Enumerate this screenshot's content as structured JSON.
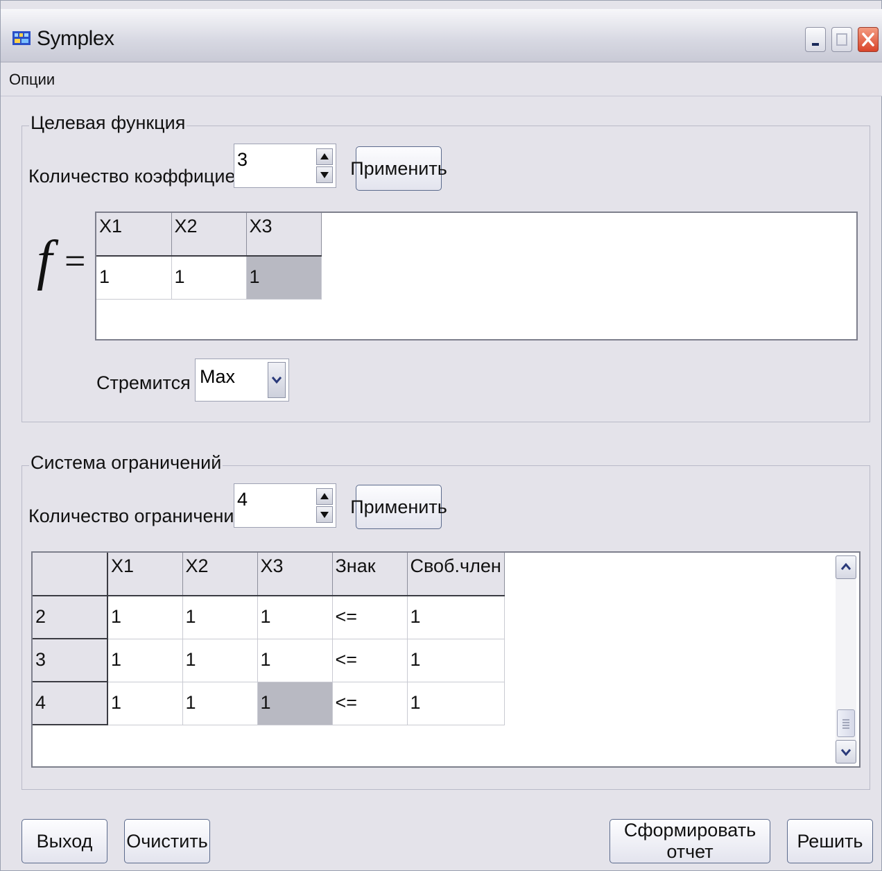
{
  "window": {
    "title": "Symplex"
  },
  "menu": {
    "items": [
      "Опции"
    ]
  },
  "objective": {
    "legend": "Целевая функция",
    "coef_count_label": "Количество коэффициентов:",
    "coef_count_value": "3",
    "apply_label": "Применить",
    "f_symbol": "f",
    "equals": "=",
    "headers": [
      "X1",
      "X2",
      "X3"
    ],
    "values": [
      "1",
      "1",
      "1"
    ],
    "goal_label": "Стремится к:",
    "goal_value": "Max"
  },
  "constraints": {
    "legend": "Система ограничений",
    "count_label": "Количество ограничений:",
    "count_value": "4",
    "apply_label": "Применить",
    "headers": [
      "",
      "X1",
      "X2",
      "X3",
      "Знак",
      "Своб.член"
    ],
    "rows": [
      {
        "id": "2",
        "cells": [
          "1",
          "1",
          "1",
          "<=",
          "1"
        ]
      },
      {
        "id": "3",
        "cells": [
          "1",
          "1",
          "1",
          "<=",
          "1"
        ]
      },
      {
        "id": "4",
        "cells": [
          "1",
          "1",
          "1",
          "<=",
          "1"
        ]
      }
    ]
  },
  "footer": {
    "exit_label": "Выход",
    "clear_label": "Очистить",
    "report_label": "Сформировать отчет",
    "solve_label": "Решить"
  },
  "colors": {
    "window_bg": "#e4e3ea",
    "selected_cell": "#b8b9c2",
    "close_button": "#d9442a"
  }
}
